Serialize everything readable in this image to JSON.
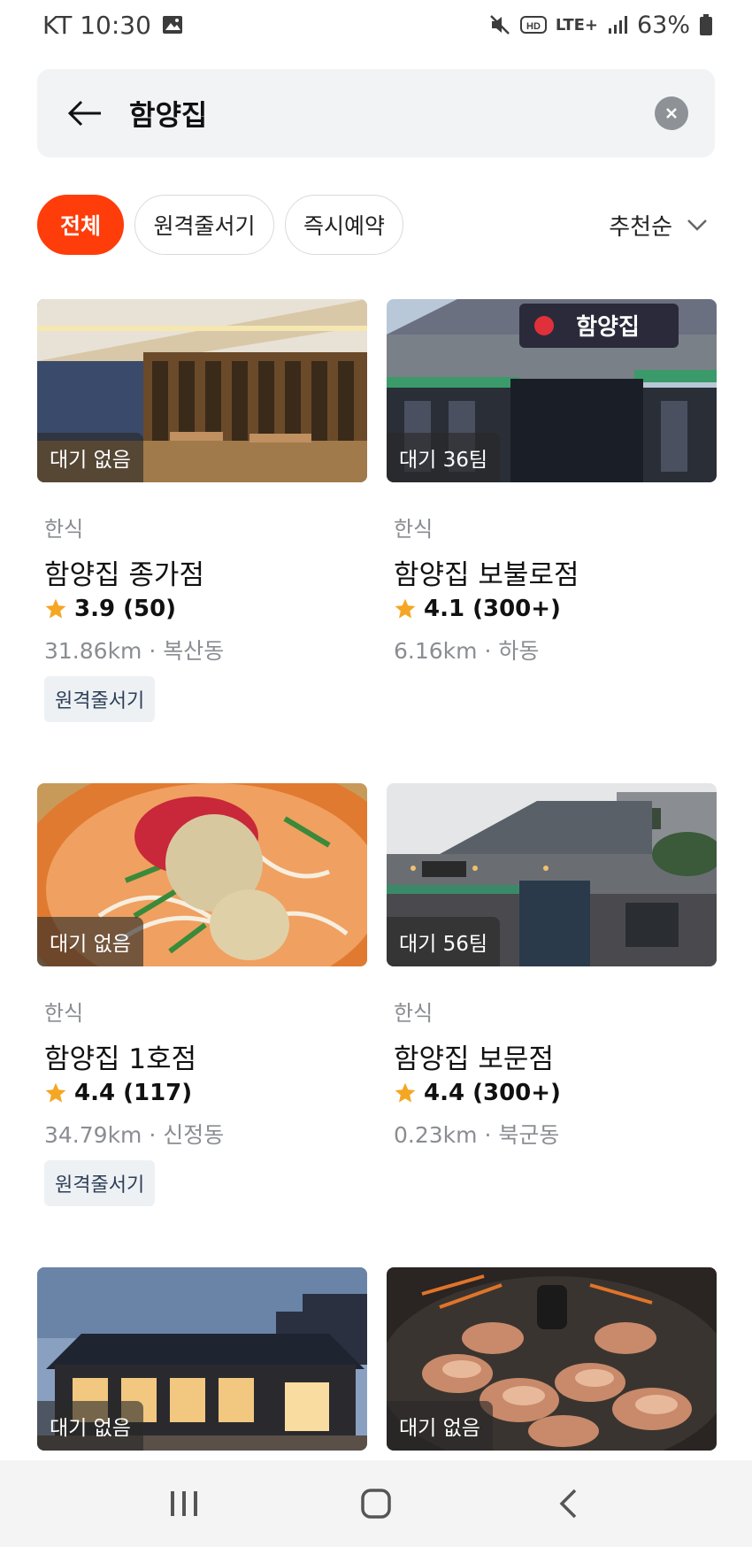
{
  "status_bar": {
    "carrier_time": "KT 10:30",
    "network": "LTE+",
    "battery": "63%"
  },
  "search": {
    "query": "함양집"
  },
  "filters": {
    "chips": [
      "전체",
      "원격줄서기",
      "즉시예약"
    ],
    "active_index": 0,
    "sort_label": "추천순"
  },
  "results": [
    {
      "wait": "대기 없음",
      "category": "한식",
      "name": "함양집 종가점",
      "rating": "3.9 (50)",
      "distance_location": "31.86km · 복산동",
      "tag": "원격줄서기",
      "photo": "restaurant-interior"
    },
    {
      "wait": "대기 36팀",
      "category": "한식",
      "name": "함양집 보불로점",
      "rating": "4.1 (300+)",
      "distance_location": "6.16km · 하동",
      "tag": "",
      "photo": "storefront"
    },
    {
      "wait": "대기 없음",
      "category": "한식",
      "name": "함양집 1호점",
      "rating": "4.4 (117)",
      "distance_location": "34.79km · 신정동",
      "tag": "원격줄서기",
      "photo": "cold-noodles"
    },
    {
      "wait": "대기 56팀",
      "category": "한식",
      "name": "함양집 보문점",
      "rating": "4.4 (300+)",
      "distance_location": "0.23km · 북군동",
      "tag": "",
      "photo": "building-exterior"
    },
    {
      "wait": "대기 없음",
      "photo": "hanok-exterior-night"
    },
    {
      "wait": "대기 없음",
      "photo": "grilled-pork-belly"
    }
  ],
  "colors": {
    "accent": "#ff3d0b",
    "star": "#f5a623",
    "tag_bg": "#eef1f4"
  }
}
